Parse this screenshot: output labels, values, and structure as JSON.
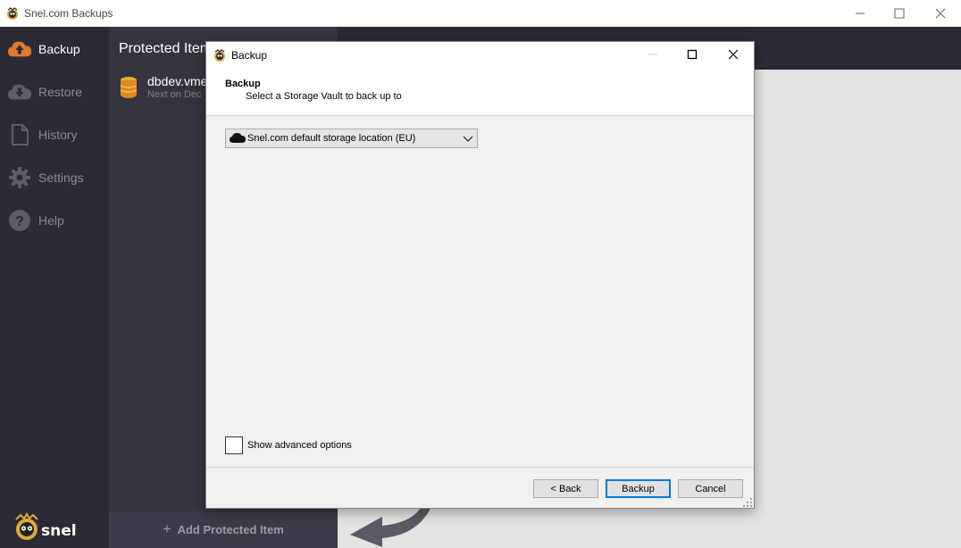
{
  "window": {
    "title": "Snel.com Backups"
  },
  "sidebar": {
    "items": [
      {
        "label": "Backup",
        "icon": "cloud-upload-icon",
        "active": true
      },
      {
        "label": "Restore",
        "icon": "cloud-download-icon",
        "active": false
      },
      {
        "label": "History",
        "icon": "document-icon",
        "active": false
      },
      {
        "label": "Settings",
        "icon": "gear-icon",
        "active": false
      },
      {
        "label": "Help",
        "icon": "help-icon",
        "active": false
      }
    ],
    "logo_text": "snel"
  },
  "list": {
    "title": "Protected Item",
    "items": [
      {
        "name": "dbdev.vme",
        "sub": "Next on Dec",
        "icon": "database-icon"
      }
    ],
    "add_label": "Add Protected Item"
  },
  "dialog": {
    "title": "Backup",
    "header_title": "Backup",
    "header_subtitle": "Select a Storage Vault to back up to",
    "vault_selected": "Snel.com default storage location (EU)",
    "advanced_label": "Show advanced options",
    "advanced_checked": false,
    "buttons": {
      "back": "< Back",
      "backup": "Backup",
      "cancel": "Cancel"
    }
  },
  "colors": {
    "sidebar_bg": "#2a2b35",
    "list_bg": "#34353f",
    "accent_orange": "#e07a2e",
    "primary_button_border": "#0078d7"
  }
}
